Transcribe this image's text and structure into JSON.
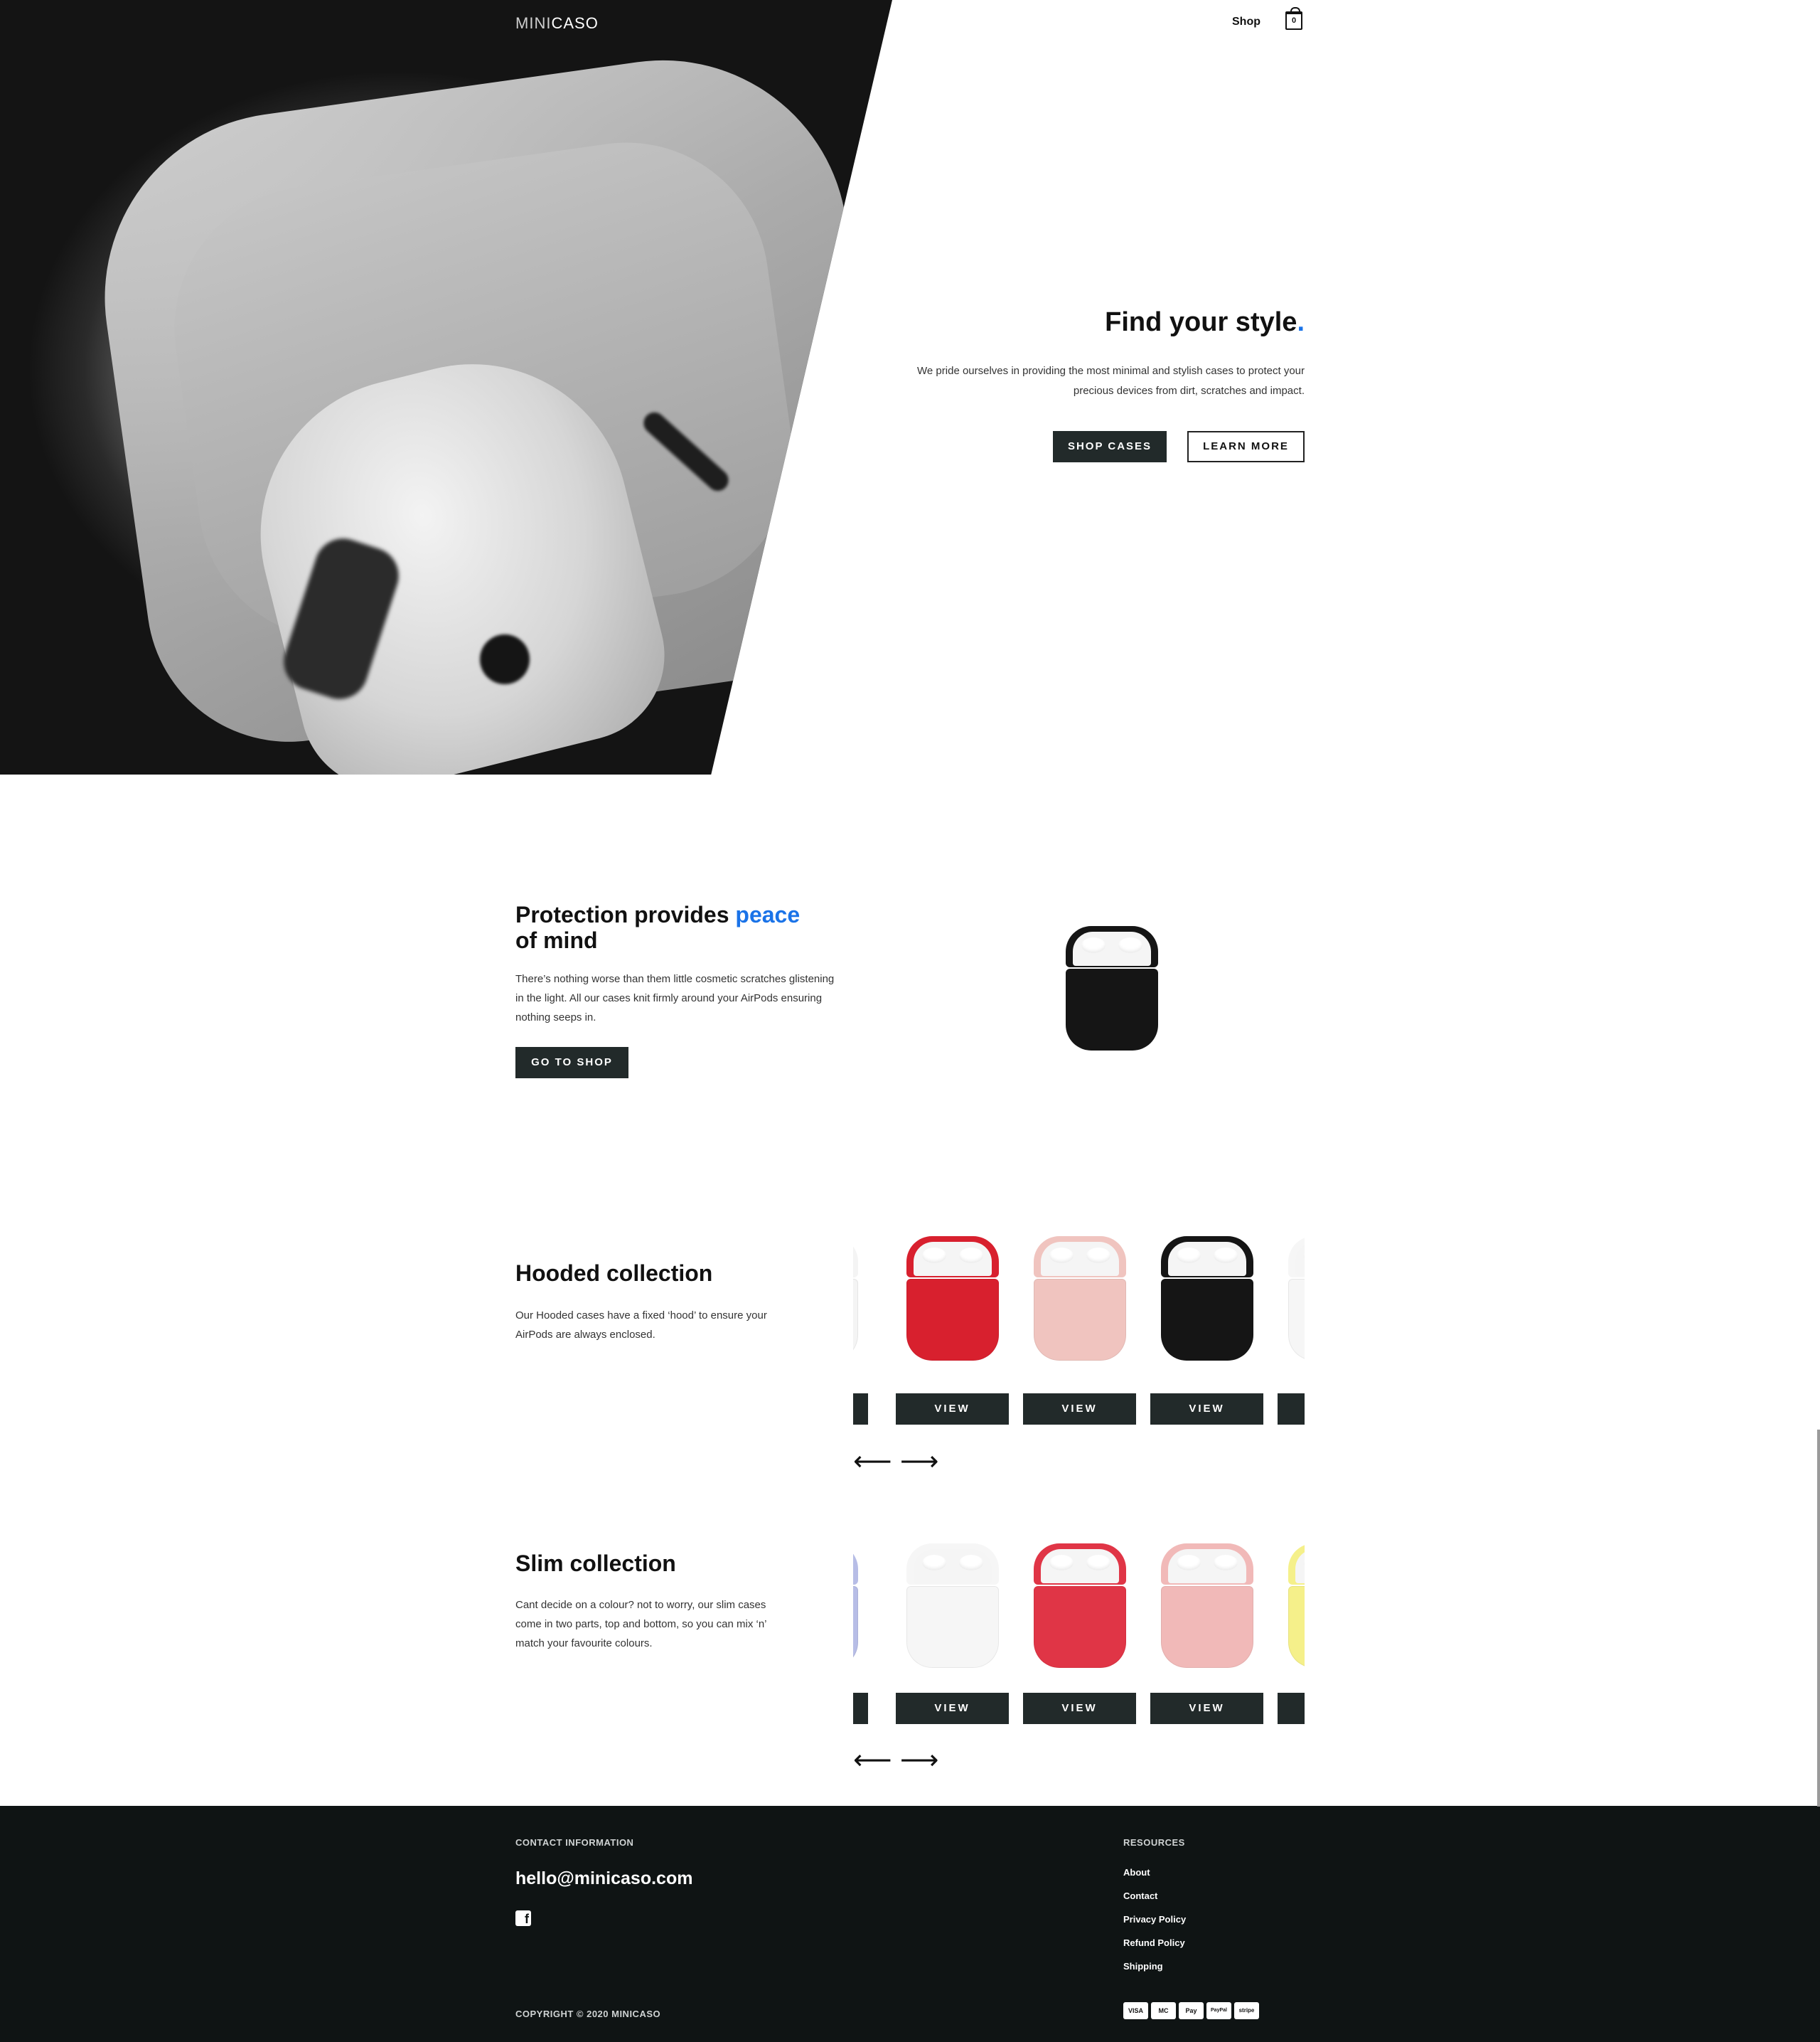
{
  "header": {
    "logo_light": "MINI",
    "logo_bold": "CASO",
    "nav_shop": "Shop",
    "cart_count": "0"
  },
  "hero": {
    "title": "Find your style",
    "title_dot": ".",
    "text": "We pride ourselves in providing the most minimal and stylish cases to protect your precious devices from dirt, scratches and impact.",
    "btn_shop": "SHOP CASES",
    "btn_learn": "LEARN MORE"
  },
  "protection": {
    "title_start": "Protection provides ",
    "title_accent": "peace",
    "title_end": "of mind",
    "text": "There’s nothing worse than them little cosmetic scratches glistening in the light. All our cases knit firmly around your AirPods ensuring nothing seeps in.",
    "btn": "GO TO SHOP"
  },
  "hooded": {
    "title": "Hooded collection",
    "text": "Our Hooded cases have a fixed ‘hood’ to ensure your AirPods are always enclosed.",
    "view_label": "VIEW",
    "prev_arrow": "⟵",
    "next_arrow": "⟶",
    "colors": [
      "#f4f4f4",
      "#d8202e",
      "#f0c4bf",
      "#151515",
      "#f6f6f6"
    ]
  },
  "slim": {
    "title": "Slim collection",
    "text": "Cant decide on a colour? not to worry, our slim cases come in two parts, top and bottom, so you can mix ‘n’ match your favourite colours.",
    "view_label": "VIEW",
    "prev_arrow": "⟵",
    "next_arrow": "⟶",
    "colors": [
      "#b7bde6",
      "#f6f6f6",
      "#e03546",
      "#f1b9b8",
      "#f5f08a"
    ]
  },
  "footer": {
    "contact_label": "CONTACT INFORMATION",
    "email": "hello@minicaso.com",
    "resources_label": "RESOURCES",
    "links": [
      "About",
      "Contact",
      "Privacy Policy",
      "Refund Policy",
      "Shipping"
    ],
    "copyright": "COPYRIGHT © 2020 MINICASO",
    "payments": [
      "VISA",
      "MC",
      "Pay",
      "PayPal",
      "stripe"
    ]
  },
  "colors": {
    "accent": "#1a73e8",
    "button_dark": "#222a2a",
    "footer_bg": "#0f1414"
  }
}
